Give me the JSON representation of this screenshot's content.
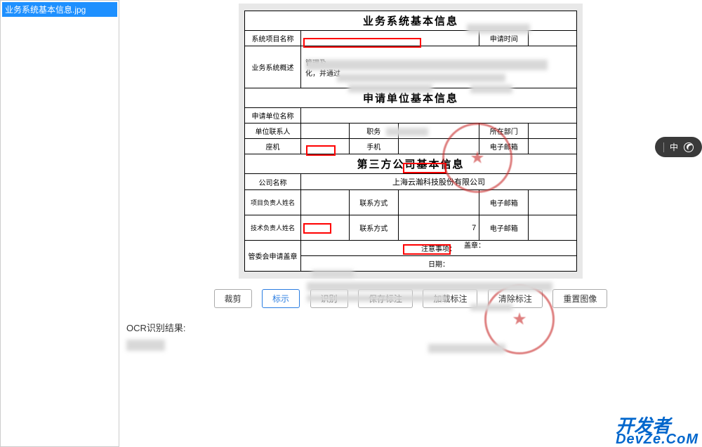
{
  "sidebar": {
    "items": [
      {
        "label": "业务系统基本信息.jpg"
      }
    ]
  },
  "document": {
    "section1": {
      "title": "业务系统基本信息",
      "row1_label1": "系统项目名称",
      "row1_label2": "申请时间",
      "row2_label": "业务系统概述",
      "row2_text1": "管理及",
      "row2_text2": "化，并通过"
    },
    "section2": {
      "title": "申请单位基本信息",
      "row1_label": "申请单位名称",
      "row2_label1": "单位联系人",
      "row2_label2": "职务",
      "row2_label3": "所在部门",
      "row3_label1": "座机",
      "row3_label2": "手机",
      "row3_label3": "电子邮箱"
    },
    "section3": {
      "title": "第三方公司基本信息",
      "row1_label": "公司名称",
      "row1_value": "上海云瀚科技股份有限公司",
      "row2_label1": "项目负责人姓名",
      "row2_label2": "联系方式",
      "row2_label3": "电子邮箱",
      "row3_label1": "技术负责人姓名",
      "row3_label2": "联系方式",
      "row3_value2_partial": "7",
      "row3_label3": "电子邮箱",
      "row4_label": "管委会申请盖章",
      "notes_label": "注意事项：",
      "stamp_label": "盖章：",
      "date_label": "日期："
    }
  },
  "toolbar": {
    "buttons": [
      {
        "key": "crop",
        "label": "裁剪",
        "active": false
      },
      {
        "key": "mark",
        "label": "标示",
        "active": true
      },
      {
        "key": "recognize",
        "label": "识别",
        "active": false
      },
      {
        "key": "save",
        "label": "保存标注",
        "active": false
      },
      {
        "key": "load",
        "label": "加载标注",
        "active": false
      },
      {
        "key": "clear",
        "label": "清除标注",
        "active": false
      },
      {
        "key": "reset",
        "label": "重置图像",
        "active": false
      }
    ]
  },
  "result": {
    "label": "OCR识别结果:"
  },
  "ime": {
    "mode": "中"
  },
  "watermark": {
    "line1": "开发者",
    "line2": "DevZe.CoM"
  }
}
